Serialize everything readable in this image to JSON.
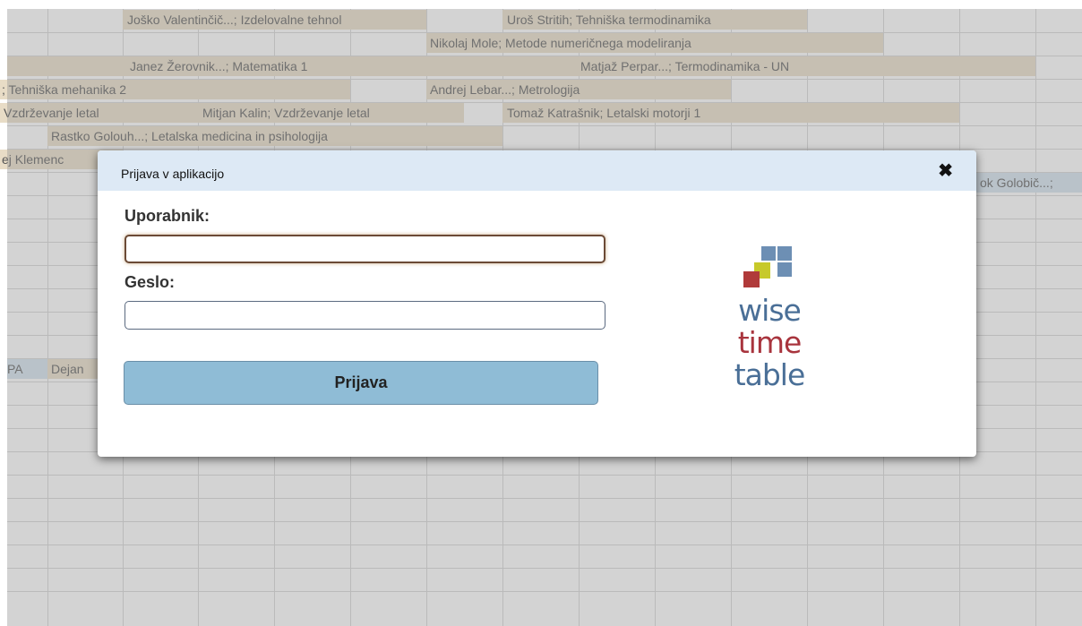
{
  "background": {
    "events": [
      {
        "text": "Joško Valentinčič...; Izdelovalne tehnol"
      },
      {
        "text": "Uroš Stritih; Tehniška termodinamika"
      },
      {
        "text": "Nikolaj Mole; Metode numeričnega modeliranja"
      },
      {
        "text": "Janez Žerovnik...; Matematika 1"
      },
      {
        "text": "Matjaž Perpar...; Termodinamika - UN"
      },
      {
        "text": "; Tehniška mehanika 2"
      },
      {
        "text": "Andrej Lebar...; Metrologija"
      },
      {
        "text": "Vzdrževanje letal"
      },
      {
        "text": "Mitjan Kalin; Vzdrževanje letal"
      },
      {
        "text": "Tomaž Katrašnik; Letalski motorji 1"
      },
      {
        "text": "Rastko Golouh...; Letalska medicina in psihologija"
      },
      {
        "text": "ej Klemenc"
      },
      {
        "text": "ok Golobič...;"
      },
      {
        "text": "PA"
      },
      {
        "text": "Dejan"
      }
    ]
  },
  "dialog": {
    "title": "Prijava v aplikacijo",
    "close_icon": "close-x-icon",
    "username_label": "Uporabnik:",
    "username_value": "",
    "password_label": "Geslo:",
    "password_value": "",
    "login_button": "Prijava"
  },
  "logo": {
    "line1": "wise",
    "line2": "time",
    "line3": "table",
    "colors": {
      "wise": "#4a6f97",
      "time": "#a8343d",
      "table": "#4a6f97",
      "square_red": "#b03a3a",
      "square_green": "#c7c92a",
      "square_blue": "#6d8fb4"
    }
  }
}
